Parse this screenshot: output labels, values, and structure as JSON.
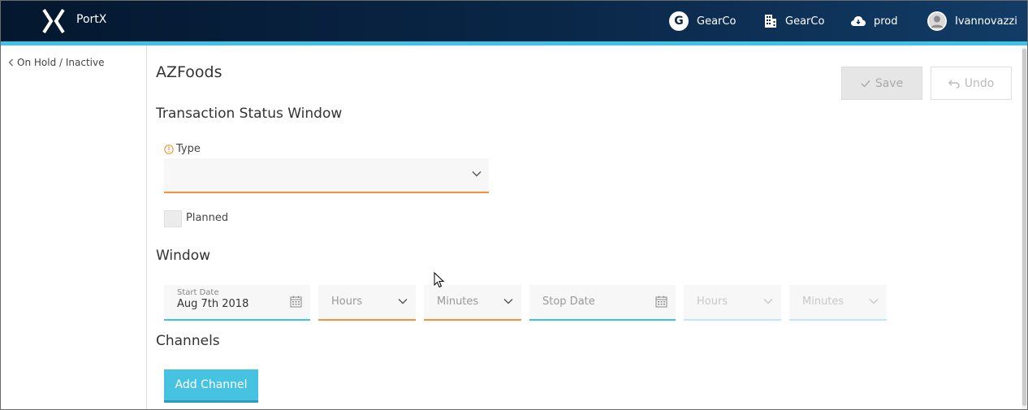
{
  "header": {
    "brand": "PortX",
    "org_badge": "G",
    "org_name": "GearCo",
    "company_name": "GearCo",
    "environment": "prod",
    "username": "Ivannovazzi"
  },
  "breadcrumb": {
    "label": "On Hold / Inactive"
  },
  "page": {
    "title": "AZFoods",
    "save_label": "Save",
    "undo_label": "Undo"
  },
  "transaction_status": {
    "title": "Transaction Status Window",
    "type_label": "Type",
    "type_value": "",
    "planned_label": "Planned",
    "planned_checked": false
  },
  "window": {
    "title": "Window",
    "start_date_label": "Start Date",
    "start_date_value": "Aug 7th 2018",
    "start_hours_placeholder": "Hours",
    "start_minutes_placeholder": "Minutes",
    "stop_date_placeholder": "Stop Date",
    "stop_hours_placeholder": "Hours",
    "stop_minutes_placeholder": "Minutes"
  },
  "channels": {
    "title": "Channels",
    "add_label": "Add Channel"
  },
  "icons": {
    "logo": "portx-logo-icon",
    "company": "building-icon",
    "environment": "cloud-icon",
    "user": "user-avatar-icon",
    "calendar": "calendar-icon",
    "dropdown": "chevron-down-icon",
    "warning": "info-circle-icon"
  },
  "colors": {
    "header_dark": "#04172e",
    "accent_blue": "#3ec3e6",
    "accent_orange": "#f0953b",
    "button_blue": "#47c3e2"
  }
}
